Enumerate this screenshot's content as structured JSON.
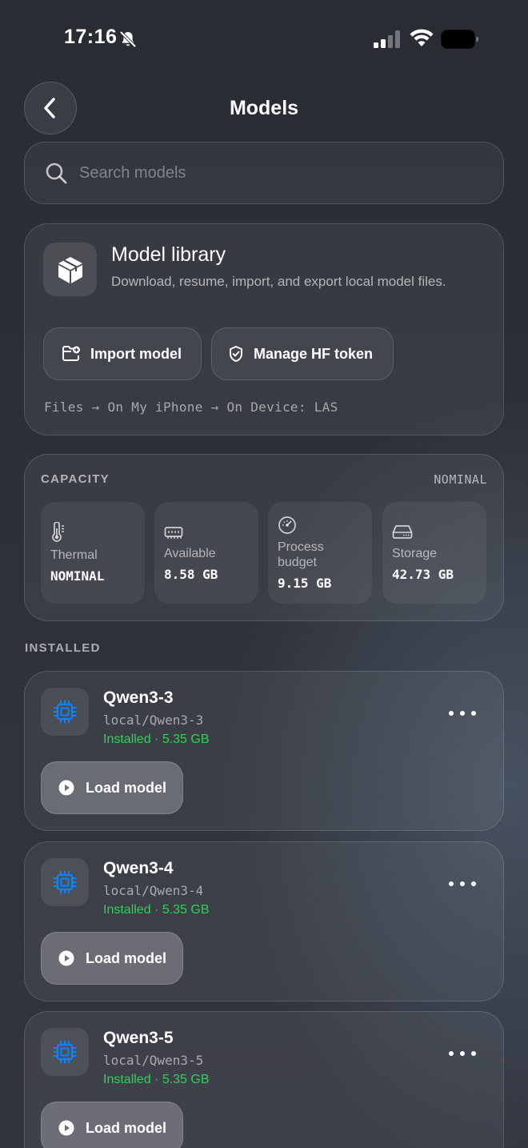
{
  "status_bar": {
    "time": "17:16"
  },
  "header": {
    "title": "Models"
  },
  "search": {
    "placeholder": "Search models"
  },
  "library": {
    "title": "Model library",
    "description": "Download, resume, import, and export local model files.",
    "import_label": "Import model",
    "token_label": "Manage HF token",
    "path_hint": "Files → On My iPhone → On Device: LAS"
  },
  "capacity": {
    "label": "CAPACITY",
    "status": "NOMINAL",
    "tiles": [
      {
        "name": "Thermal",
        "value": "NOMINAL",
        "icon": "thermometer-icon"
      },
      {
        "name": "Available",
        "value": "8.58 GB",
        "icon": "memory-icon"
      },
      {
        "name": "Process budget",
        "value": "9.15 GB",
        "icon": "gauge-icon"
      },
      {
        "name": "Storage",
        "value": "42.73 GB",
        "icon": "drive-icon"
      }
    ]
  },
  "installed": {
    "label": "INSTALLED",
    "models": [
      {
        "name": "Qwen3-3",
        "path": "local/Qwen3-3",
        "status": "Installed · 5.35 GB",
        "action": "Load model"
      },
      {
        "name": "Qwen3-4",
        "path": "local/Qwen3-4",
        "status": "Installed · 5.35 GB",
        "action": "Load model"
      },
      {
        "name": "Qwen3-5",
        "path": "local/Qwen3-5",
        "status": "Installed · 5.35 GB",
        "action": "Load model"
      }
    ]
  },
  "colors": {
    "accent_blue": "#0a84ff",
    "installed_green": "#30d158"
  }
}
